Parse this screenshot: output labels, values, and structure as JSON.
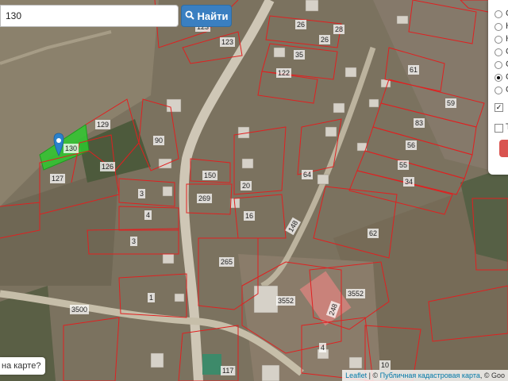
{
  "search": {
    "value": "130",
    "button_label": "Найти",
    "button_icon": "search-icon"
  },
  "layers": {
    "radios": [
      {
        "label": "С",
        "selected": false
      },
      {
        "label": "К",
        "selected": false
      },
      {
        "label": "К",
        "selected": false
      },
      {
        "label": "С",
        "selected": false
      },
      {
        "label": "С",
        "selected": false
      },
      {
        "label": "С",
        "selected": true
      },
      {
        "label": "С",
        "selected": false
      }
    ],
    "checkboxes": [
      {
        "label": "",
        "checked": true
      },
      {
        "label": "Т",
        "checked": false
      }
    ]
  },
  "popup_hint": "на карте?",
  "attribution": {
    "leaflet": "Leaflet",
    "separator": " | © ",
    "source": "Публичная кадастровая карта",
    "extra": ", © Goo"
  },
  "colors": {
    "parcel_border": "#e02020",
    "selected_parcel": "#2ec82e",
    "marker": "#2a81cb",
    "button": "#3a7fc1"
  },
  "parcels": {
    "p130": "130",
    "p129": "129",
    "p126": "126",
    "p127": "127",
    "p90": "90",
    "p150": "150",
    "p269": "269",
    "p3a": "3",
    "p4": "4",
    "p3b": "3",
    "p265": "265",
    "p1": "1",
    "p3500": "3500",
    "p20": "20",
    "p16": "16",
    "p64": "64",
    "p62": "62",
    "p3552a": "3552",
    "p3552b": "3552",
    "p248": "248",
    "p26": "26",
    "p26b": "26",
    "p35": "35",
    "p122": "122",
    "p123": "123",
    "p123b": "123",
    "p61": "61",
    "p59": "59",
    "p83": "83",
    "p56": "56",
    "p55": "55",
    "p34": "34",
    "p117": "117",
    "p4b": "4",
    "p10": "10",
    "p148": "148",
    "p28": "28"
  }
}
